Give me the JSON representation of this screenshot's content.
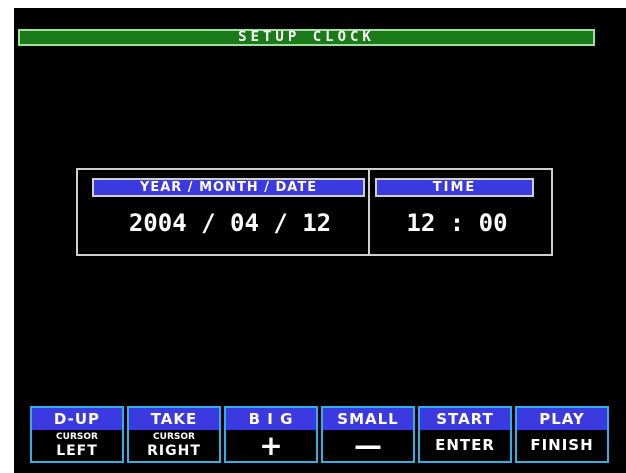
{
  "screen": {
    "title": "SETUP CLOCK"
  },
  "clock": {
    "date_header": "YEAR / MONTH / DATE",
    "time_header": "TIME",
    "date_value": "2004 / 04 / 12",
    "time_value": "12 : 00"
  },
  "keys": [
    {
      "top": "D-UP",
      "small": "CURSOR",
      "big": "LEFT"
    },
    {
      "top": "TAKE",
      "small": "CURSOR",
      "big": "RIGHT"
    },
    {
      "top": "B I G",
      "symbol": "+",
      "symbol_icon": "plus-icon"
    },
    {
      "top": "SMALL",
      "symbol": "—",
      "symbol_icon": "minus-icon"
    },
    {
      "top": "START",
      "label": "ENTER"
    },
    {
      "top": "PLAY",
      "label": "FINISH"
    }
  ],
  "colors": {
    "background": "#000000",
    "title_bar": "#1a7a1a",
    "header_blue": "#3a3ae0",
    "key_border": "#2fb0e6"
  }
}
